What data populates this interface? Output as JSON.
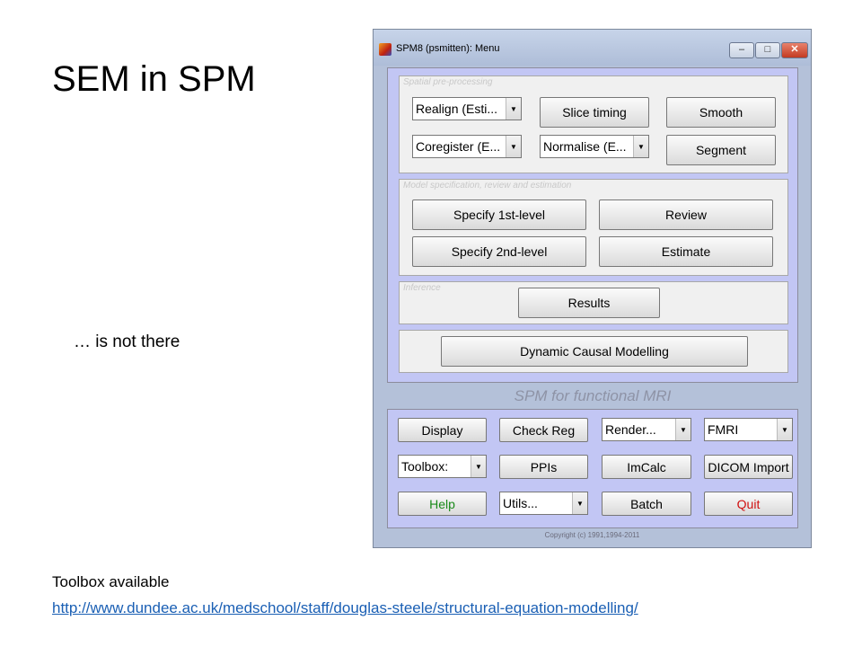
{
  "slide": {
    "title": "SEM in SPM",
    "note": "… is not there",
    "toolbox_label": "Toolbox available",
    "url": "http://www.dundee.ac.uk/medschool/staff/douglas-steele/structural-equation-modelling/"
  },
  "window": {
    "title": "SPM8 (psmitten): Menu",
    "minimize": "–",
    "maximize": "□",
    "close": "✕"
  },
  "spatial": {
    "label": "Spatial pre-processing",
    "realign": "Realign (Esti...",
    "slice_timing": "Slice timing",
    "smooth": "Smooth",
    "coregister": "Coregister (E...",
    "normalise": "Normalise (E...",
    "segment": "Segment"
  },
  "model": {
    "label": "Model specification, review and estimation",
    "specify_1st": "Specify 1st-level",
    "review": "Review",
    "specify_2nd": "Specify 2nd-level",
    "estimate": "Estimate"
  },
  "inference": {
    "label": "Inference",
    "results": "Results"
  },
  "dcm": {
    "label": "Dynamic Causal Modelling"
  },
  "banner": "SPM for functional MRI",
  "utilities": {
    "display": "Display",
    "check_reg": "Check Reg",
    "render": "Render...",
    "fmri": "FMRI",
    "toolbox": "Toolbox:",
    "ppis": "PPIs",
    "imcalc": "ImCalc",
    "dicom_import": "DICOM Import",
    "help": "Help",
    "utils": "Utils...",
    "batch": "Batch",
    "quit": "Quit"
  },
  "copyright": "Copyright (c) 1991,1994-2011",
  "colors": {
    "help_text": "#1a8a1a",
    "quit_text": "#d01010",
    "panel_bg": "#c2c6f4",
    "link": "#1a5fb4"
  }
}
